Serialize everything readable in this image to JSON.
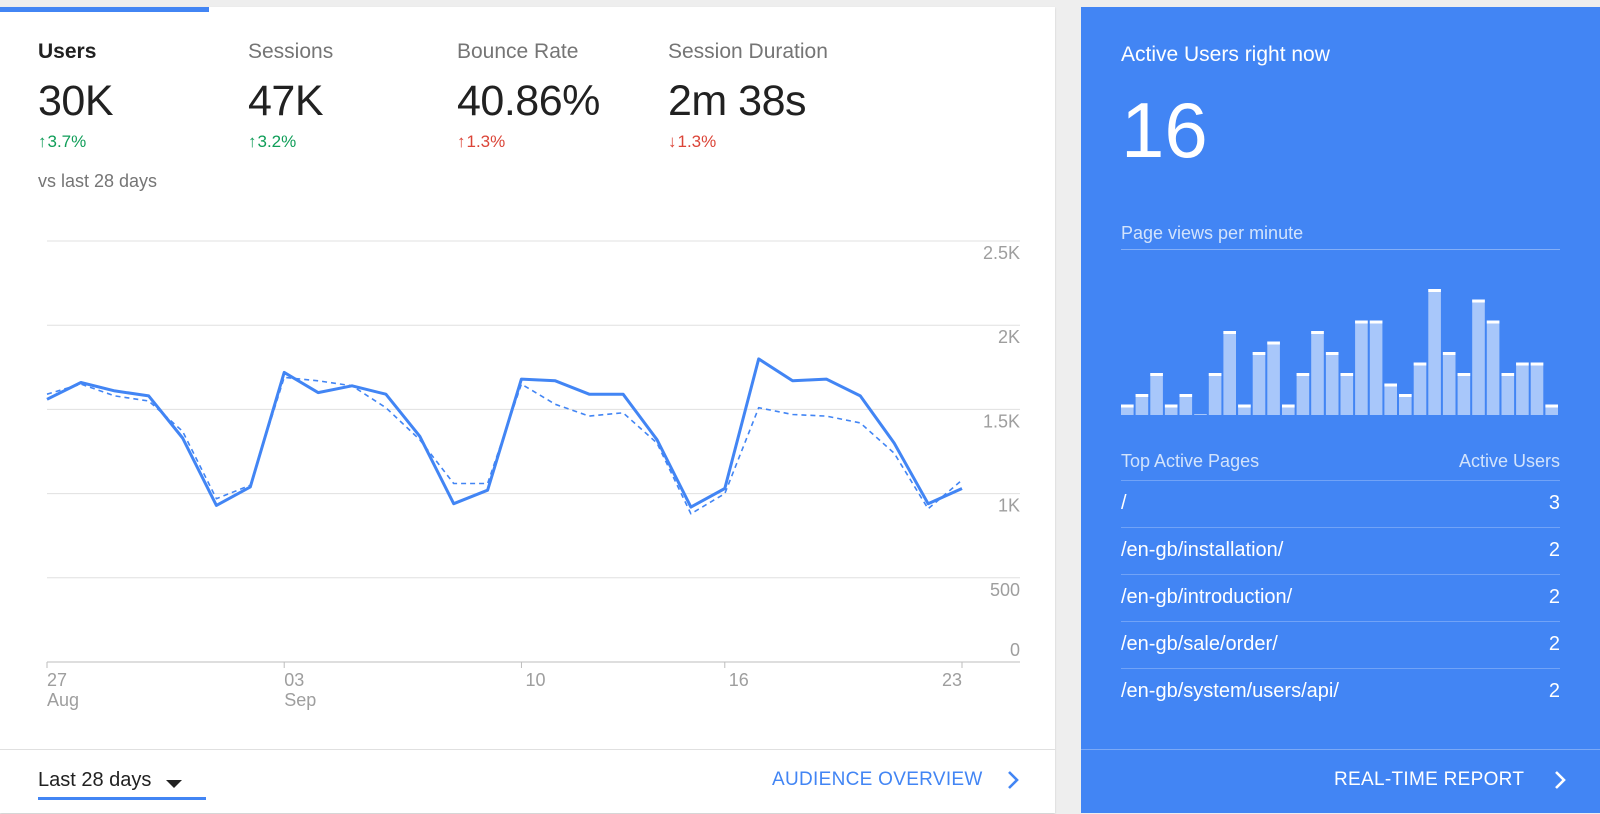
{
  "metrics": [
    {
      "label": "Users",
      "value": "30K",
      "change": "3.7%",
      "direction": "up",
      "color": "#0f9d58",
      "active": true
    },
    {
      "label": "Sessions",
      "value": "47K",
      "change": "3.2%",
      "direction": "up",
      "color": "#0f9d58",
      "active": false
    },
    {
      "label": "Bounce Rate",
      "value": "40.86%",
      "change": "1.3%",
      "direction": "up",
      "color": "#db4437",
      "active": false
    },
    {
      "label": "Session Duration",
      "value": "2m 38s",
      "change": "1.3%",
      "direction": "down",
      "color": "#db4437",
      "active": false
    }
  ],
  "compare_note": "vs last 28 days",
  "footer": {
    "date_range": "Last 28 days",
    "audience_link": "AUDIENCE OVERVIEW"
  },
  "chart_data": {
    "type": "line",
    "y_ticks": [
      "2.5K",
      "2K",
      "1.5K",
      "1K",
      "500",
      "0"
    ],
    "ylim": [
      0,
      2500
    ],
    "x_ticks": [
      {
        "index": 0,
        "day": "27",
        "month": "Aug"
      },
      {
        "index": 7,
        "day": "03",
        "month": "Sep"
      },
      {
        "index": 14,
        "day": "10",
        "month": ""
      },
      {
        "index": 20,
        "day": "16",
        "month": ""
      },
      {
        "index": 27,
        "day": "23",
        "month": ""
      }
    ],
    "series": [
      {
        "style": "solid",
        "values": [
          1560,
          1660,
          1610,
          1580,
          1330,
          930,
          1040,
          1720,
          1600,
          1640,
          1590,
          1340,
          940,
          1020,
          1680,
          1670,
          1590,
          1590,
          1320,
          920,
          1030,
          1800,
          1670,
          1680,
          1580,
          1300,
          940,
          1030
        ]
      },
      {
        "style": "dashed",
        "values": [
          1590,
          1650,
          1580,
          1550,
          1370,
          970,
          1050,
          1690,
          1670,
          1640,
          1510,
          1320,
          1060,
          1060,
          1650,
          1530,
          1460,
          1480,
          1300,
          880,
          1000,
          1510,
          1470,
          1460,
          1420,
          1240,
          910,
          1080
        ]
      }
    ],
    "colors": {
      "line": "#4285f4",
      "grid": "#e0e0e0"
    }
  },
  "realtime": {
    "title": "Active Users right now",
    "count": "16",
    "pageviews_label": "Page views per minute",
    "pageviews_per_minute": [
      1,
      2,
      4,
      1,
      2,
      0,
      4,
      8,
      1,
      6,
      7,
      1,
      4,
      8,
      6,
      4,
      9,
      9,
      3,
      2,
      5,
      12,
      6,
      4,
      11,
      9,
      4,
      5,
      5,
      1
    ],
    "top_pages_header": "Top Active Pages",
    "active_users_header": "Active Users",
    "top_pages": [
      {
        "path": "/",
        "users": "3"
      },
      {
        "path": "/en-gb/installation/",
        "users": "2"
      },
      {
        "path": "/en-gb/introduction/",
        "users": "2"
      },
      {
        "path": "/en-gb/sale/order/",
        "users": "2"
      },
      {
        "path": "/en-gb/system/users/api/",
        "users": "2"
      }
    ],
    "report_link": "REAL-TIME REPORT",
    "bg_color": "#4285f4"
  }
}
